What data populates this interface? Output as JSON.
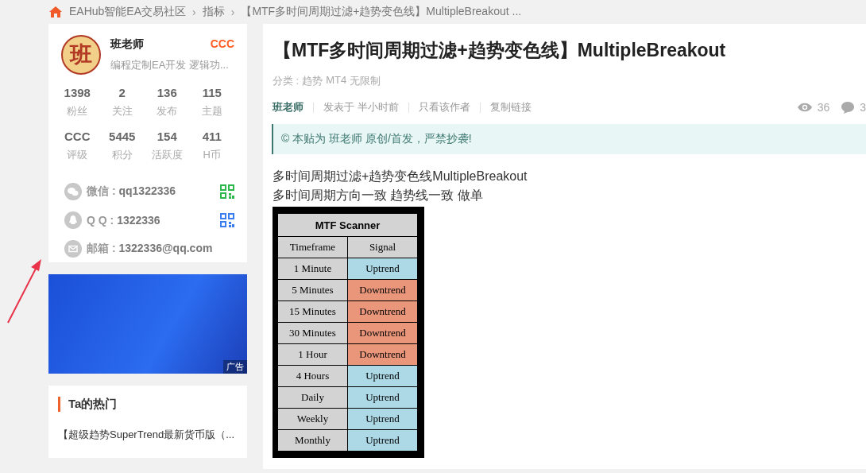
{
  "breadcrumb": {
    "separator": "›",
    "items": [
      "EAHub智能EA交易社区",
      "指标",
      "【MTF多时间周期过滤+趋势变色线】MultipleBreakout ..."
    ]
  },
  "author": {
    "avatar_char": "班",
    "name": "班老师",
    "level": "CCC",
    "bio": "编程定制EA开发 逻辑功...",
    "stats": [
      {
        "value": "1398",
        "label": "粉丝"
      },
      {
        "value": "2",
        "label": "关注"
      },
      {
        "value": "136",
        "label": "发布"
      },
      {
        "value": "115",
        "label": "主题"
      },
      {
        "value": "CCC",
        "label": "评级"
      },
      {
        "value": "5445",
        "label": "积分"
      },
      {
        "value": "154",
        "label": "活跃度"
      },
      {
        "value": "411",
        "label": "H币"
      }
    ],
    "contacts": [
      {
        "kind": "wechat",
        "label": "微信 : ",
        "value": "qq1322336",
        "qr": true
      },
      {
        "kind": "qq",
        "label": "Q Q : ",
        "value": "1322336",
        "qr": true
      },
      {
        "kind": "email",
        "label": "邮箱 : ",
        "value": "1322336@qq.com",
        "qr": false
      }
    ]
  },
  "ad": {
    "label": "广告"
  },
  "hot": {
    "title": "Ta的热门",
    "items": [
      "【超级趋势SuperTrend最新货币版（..."
    ]
  },
  "article": {
    "title": "【MTF多时间周期过滤+趋势变色线】MultipleBreakout",
    "category_label": "分类 : ",
    "tags": [
      "趋势",
      "MT4",
      "无限制"
    ],
    "meta": {
      "author": "班老师",
      "posted": "发表于 半小时前",
      "links": [
        "只看该作者",
        "复制链接"
      ],
      "views": "36",
      "comments": "3"
    },
    "notice": "© 本贴为 班老师 原创/首发，严禁抄袭!",
    "body": [
      "多时间周期过滤+趋势变色线MultipleBreakout",
      "多时间周期方向一致  趋势线一致  做单"
    ],
    "scanner": {
      "title": "MTF Scanner",
      "columns": [
        "Timeframe",
        "Signal"
      ],
      "rows": [
        {
          "timeframe": "1 Minute",
          "signal": "Uptrend",
          "color": "#add8e6"
        },
        {
          "timeframe": "5 Minutes",
          "signal": "Downtrend",
          "color": "#e9967a"
        },
        {
          "timeframe": "15 Minutes",
          "signal": "Downtrend",
          "color": "#e9967a"
        },
        {
          "timeframe": "30 Minutes",
          "signal": "Downtrend",
          "color": "#e9967a"
        },
        {
          "timeframe": "1 Hour",
          "signal": "Downtrend",
          "color": "#e9967a"
        },
        {
          "timeframe": "4 Hours",
          "signal": "Uptrend",
          "color": "#add8e6"
        },
        {
          "timeframe": "Daily",
          "signal": "Uptrend",
          "color": "#add8e6"
        },
        {
          "timeframe": "Weekly",
          "signal": "Uptrend",
          "color": "#add8e6"
        },
        {
          "timeframe": "Monthly",
          "signal": "Uptrend",
          "color": "#add8e6"
        }
      ]
    }
  }
}
